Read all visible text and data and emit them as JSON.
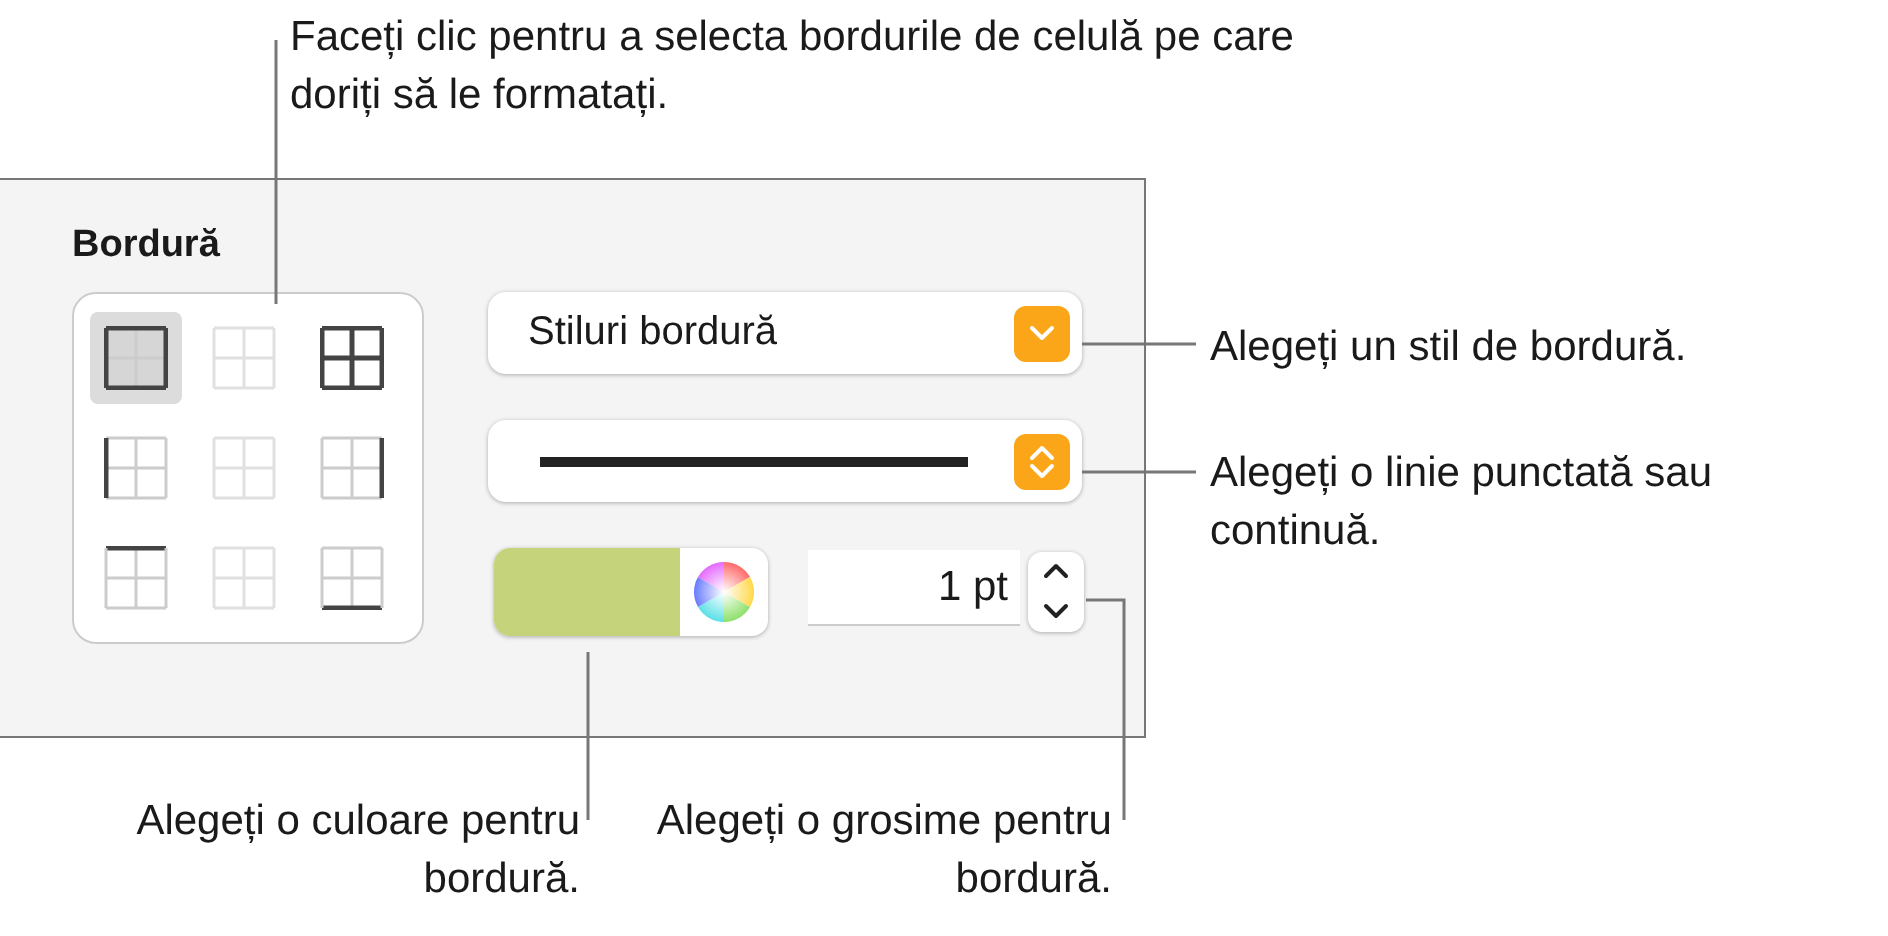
{
  "panel": {
    "title": "Bordură",
    "border_buttons": [
      {
        "kind": "outer",
        "selected": true
      },
      {
        "kind": "inner",
        "selected": false
      },
      {
        "kind": "all",
        "selected": false
      },
      {
        "kind": "left",
        "selected": false
      },
      {
        "kind": "vertical",
        "selected": false
      },
      {
        "kind": "right",
        "selected": false
      },
      {
        "kind": "top",
        "selected": false
      },
      {
        "kind": "horizontal",
        "selected": false
      },
      {
        "kind": "bottom",
        "selected": false
      }
    ],
    "style_dropdown": {
      "label": "Stiluri bordură"
    },
    "line_dropdown": {
      "kind": "solid"
    },
    "color_well": {
      "color": "#c5d47a"
    },
    "width_field": {
      "value": "1 pt"
    }
  },
  "callouts": [
    {
      "text": "Faceți clic pentru a selecta bordurile de celulă pe care doriți să le formatați."
    },
    {
      "text": "Alegeți un stil de bordură."
    },
    {
      "text": "Alegeți o linie punctată sau continuă."
    },
    {
      "text": "Alegeți o culoare pentru bordură."
    },
    {
      "text": "Alegeți o grosime pentru bordură."
    }
  ]
}
